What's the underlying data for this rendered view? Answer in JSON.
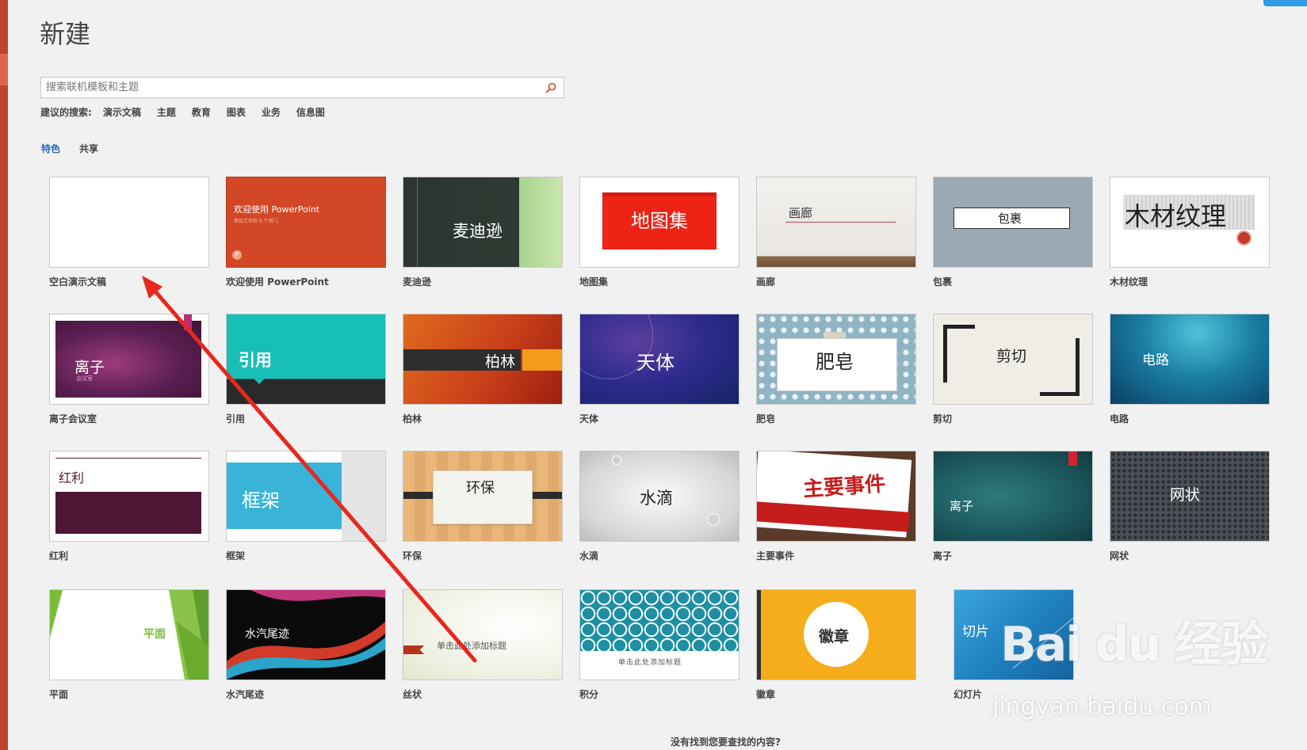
{
  "page": {
    "title": "新建"
  },
  "search": {
    "placeholder": "搜索联机模板和主题"
  },
  "suggested": {
    "label": "建议的搜索:",
    "items": [
      "演示文稿",
      "主题",
      "教育",
      "图表",
      "业务",
      "信息图"
    ]
  },
  "tabs": [
    {
      "label": "特色",
      "active": true
    },
    {
      "label": "共享",
      "active": false
    }
  ],
  "templates": [
    {
      "name": "空白演示文稿"
    },
    {
      "name": "欢迎使用 PowerPoint",
      "thumb_title": "欢迎使用 PowerPoint",
      "thumb_sub": "简化工作的 5 个窍门"
    },
    {
      "name": "麦迪逊",
      "thumb_title": "麦迪逊"
    },
    {
      "name": "地图集",
      "thumb_title": "地图集"
    },
    {
      "name": "画廊",
      "thumb_title": "画廊"
    },
    {
      "name": "包裹",
      "thumb_title": "包裹"
    },
    {
      "name": "木材纹理",
      "thumb_title": "木材纹理"
    },
    {
      "name": "离子会议室",
      "thumb_title": "离子",
      "thumb_sub": "会议室"
    },
    {
      "name": "引用",
      "thumb_title": "引用"
    },
    {
      "name": "柏林",
      "thumb_title": "柏林"
    },
    {
      "name": "天体",
      "thumb_title": "天体"
    },
    {
      "name": "肥皂",
      "thumb_title": "肥皂"
    },
    {
      "name": "剪切",
      "thumb_title": "剪切"
    },
    {
      "name": "电路",
      "thumb_title": "电路"
    },
    {
      "name": "红利",
      "thumb_title": "红利"
    },
    {
      "name": "框架",
      "thumb_title": "框架"
    },
    {
      "name": "环保",
      "thumb_title": "环保"
    },
    {
      "name": "水滴",
      "thumb_title": "水滴"
    },
    {
      "name": "主要事件",
      "thumb_title": "主要事件"
    },
    {
      "name": "离子",
      "thumb_title": "离子"
    },
    {
      "name": "网状",
      "thumb_title": "网状"
    },
    {
      "name": "平面",
      "thumb_title": "平面"
    },
    {
      "name": "水汽尾迹",
      "thumb_title": "水汽尾迹"
    },
    {
      "name": "丝状",
      "thumb_title": "单击此处添加标题"
    },
    {
      "name": "积分",
      "thumb_title": "单击此处添加标题"
    },
    {
      "name": "徽章",
      "thumb_title": "徽章"
    },
    {
      "name": "幻灯片",
      "thumb_title": "切片"
    }
  ],
  "footer": {
    "note": "没有找到您要查找的内容?"
  },
  "watermark": {
    "brand": "Bai du 经验",
    "url": "jingyan.baidu.com"
  },
  "colors": {
    "accent_tab": "#2a6bb6",
    "ppt_orange": "#d24726",
    "annotation_arrow": "#e8281e"
  }
}
